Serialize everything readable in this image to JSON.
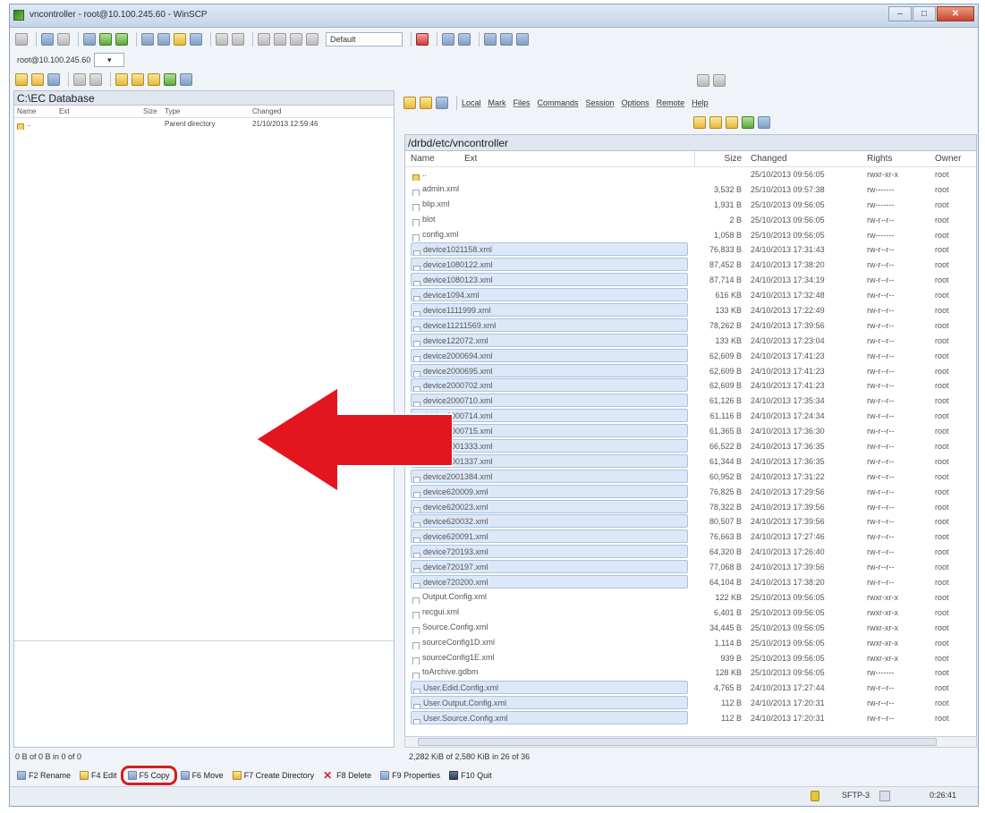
{
  "window": {
    "title": "vncontroller - root@10.100.245.60 - WinSCP",
    "controls": [
      "–",
      "□",
      "✕"
    ]
  },
  "toolbar": {
    "profile_dropdown": "Default"
  },
  "session": {
    "tab_label": "root@10.100.245.60",
    "new_tab": "▾"
  },
  "left_panel": {
    "path": "C:\\EC Database",
    "columns": {
      "name": "Name",
      "ext": "Ext",
      "size": "Size",
      "type": "Type",
      "changed": "Changed"
    },
    "rows": [
      {
        "name": "..",
        "ext": "",
        "size": "",
        "type": "Parent directory",
        "changed": "21/10/2013 12:59:46"
      }
    ],
    "status": "0 B of 0 B in 0 of 0"
  },
  "right_panel": {
    "menu": [
      "Local",
      "Mark",
      "Files",
      "Commands",
      "Session",
      "Options",
      "Remote",
      "Help"
    ],
    "path": "/drbd/etc/vncontroller",
    "columns": {
      "name": "Name",
      "ext": "Ext",
      "size": "Size",
      "changed": "Changed",
      "rights": "Rights",
      "owner": "Owner"
    },
    "rows": [
      {
        "name": "..",
        "size": "",
        "changed": "25/10/2013 09:56:05",
        "rights": "rwxr-xr-x",
        "owner": "root",
        "selected": false,
        "up": true
      },
      {
        "name": "admin.xml",
        "size": "3,532 B",
        "changed": "25/10/2013 09:57:38",
        "rights": "rw-------",
        "owner": "root",
        "selected": false
      },
      {
        "name": "blip.xml",
        "size": "1,931 B",
        "changed": "25/10/2013 09:56:05",
        "rights": "rw-------",
        "owner": "root",
        "selected": false
      },
      {
        "name": "blot",
        "size": "2 B",
        "changed": "25/10/2013 09:56:05",
        "rights": "rw-r--r--",
        "owner": "root",
        "selected": false
      },
      {
        "name": "config.xml",
        "size": "1,058 B",
        "changed": "25/10/2013 09:56:05",
        "rights": "rw-------",
        "owner": "root",
        "selected": false
      },
      {
        "name": "device1021158.xml",
        "size": "76,833 B",
        "changed": "24/10/2013 17:31:43",
        "rights": "rw-r--r--",
        "owner": "root",
        "selected": true
      },
      {
        "name": "device1080122.xml",
        "size": "87,452 B",
        "changed": "24/10/2013 17:38:20",
        "rights": "rw-r--r--",
        "owner": "root",
        "selected": true
      },
      {
        "name": "device1080123.xml",
        "size": "87,714 B",
        "changed": "24/10/2013 17:34:19",
        "rights": "rw-r--r--",
        "owner": "root",
        "selected": true
      },
      {
        "name": "device1094.xml",
        "size": "616 KB",
        "changed": "24/10/2013 17:32:48",
        "rights": "rw-r--r--",
        "owner": "root",
        "selected": true
      },
      {
        "name": "device1111999.xml",
        "size": "133 KB",
        "changed": "24/10/2013 17:22:49",
        "rights": "rw-r--r--",
        "owner": "root",
        "selected": true
      },
      {
        "name": "device11211569.xml",
        "size": "78,262 B",
        "changed": "24/10/2013 17:39:56",
        "rights": "rw-r--r--",
        "owner": "root",
        "selected": true
      },
      {
        "name": "device122072.xml",
        "size": "133 KB",
        "changed": "24/10/2013 17:23:04",
        "rights": "rw-r--r--",
        "owner": "root",
        "selected": true
      },
      {
        "name": "device2000694.xml",
        "size": "62,609 B",
        "changed": "24/10/2013 17:41:23",
        "rights": "rw-r--r--",
        "owner": "root",
        "selected": true
      },
      {
        "name": "device2000695.xml",
        "size": "62,609 B",
        "changed": "24/10/2013 17:41:23",
        "rights": "rw-r--r--",
        "owner": "root",
        "selected": true
      },
      {
        "name": "device2000702.xml",
        "size": "62,609 B",
        "changed": "24/10/2013 17:41:23",
        "rights": "rw-r--r--",
        "owner": "root",
        "selected": true
      },
      {
        "name": "device2000710.xml",
        "size": "61,126 B",
        "changed": "24/10/2013 17:35:34",
        "rights": "rw-r--r--",
        "owner": "root",
        "selected": true
      },
      {
        "name": "device2000714.xml",
        "size": "61,116 B",
        "changed": "24/10/2013 17:24:34",
        "rights": "rw-r--r--",
        "owner": "root",
        "selected": true
      },
      {
        "name": "device2000715.xml",
        "size": "61,365 B",
        "changed": "24/10/2013 17:36:30",
        "rights": "rw-r--r--",
        "owner": "root",
        "selected": true
      },
      {
        "name": "device2001333.xml",
        "size": "66,522 B",
        "changed": "24/10/2013 17:36:35",
        "rights": "rw-r--r--",
        "owner": "root",
        "selected": true
      },
      {
        "name": "device2001337.xml",
        "size": "61,344 B",
        "changed": "24/10/2013 17:36:35",
        "rights": "rw-r--r--",
        "owner": "root",
        "selected": true
      },
      {
        "name": "device2001384.xml",
        "size": "60,952 B",
        "changed": "24/10/2013 17:31:22",
        "rights": "rw-r--r--",
        "owner": "root",
        "selected": true
      },
      {
        "name": "device620009.xml",
        "size": "76,825 B",
        "changed": "24/10/2013 17:29:56",
        "rights": "rw-r--r--",
        "owner": "root",
        "selected": true
      },
      {
        "name": "device620023.xml",
        "size": "78,322 B",
        "changed": "24/10/2013 17:39:56",
        "rights": "rw-r--r--",
        "owner": "root",
        "selected": true
      },
      {
        "name": "device620032.xml",
        "size": "80,507 B",
        "changed": "24/10/2013 17:39:56",
        "rights": "rw-r--r--",
        "owner": "root",
        "selected": true
      },
      {
        "name": "device620091.xml",
        "size": "76,663 B",
        "changed": "24/10/2013 17:27:46",
        "rights": "rw-r--r--",
        "owner": "root",
        "selected": true
      },
      {
        "name": "device720193.xml",
        "size": "64,320 B",
        "changed": "24/10/2013 17:26:40",
        "rights": "rw-r--r--",
        "owner": "root",
        "selected": true
      },
      {
        "name": "device720197.xml",
        "size": "77,068 B",
        "changed": "24/10/2013 17:39:56",
        "rights": "rw-r--r--",
        "owner": "root",
        "selected": true
      },
      {
        "name": "device720200.xml",
        "size": "64,104 B",
        "changed": "24/10/2013 17:38:20",
        "rights": "rw-r--r--",
        "owner": "root",
        "selected": true
      },
      {
        "name": "Output.Config.xml",
        "size": "122 KB",
        "changed": "25/10/2013 09:56:05",
        "rights": "rwxr-xr-x",
        "owner": "root",
        "selected": false
      },
      {
        "name": "recgui.xml",
        "size": "6,401 B",
        "changed": "25/10/2013 09:56:05",
        "rights": "rwxr-xr-x",
        "owner": "root",
        "selected": false
      },
      {
        "name": "Source.Config.xml",
        "size": "34,445 B",
        "changed": "25/10/2013 09:56:05",
        "rights": "rwxr-xr-x",
        "owner": "root",
        "selected": false
      },
      {
        "name": "sourceConfig1D.xml",
        "size": "1,114 B",
        "changed": "25/10/2013 09:56:05",
        "rights": "rwxr-xr-x",
        "owner": "root",
        "selected": false
      },
      {
        "name": "sourceConfig1E.xml",
        "size": "939 B",
        "changed": "25/10/2013 09:56:05",
        "rights": "rwxr-xr-x",
        "owner": "root",
        "selected": false
      },
      {
        "name": "toArchive.gdbm",
        "size": "128 KB",
        "changed": "25/10/2013 09:56:05",
        "rights": "rw-------",
        "owner": "root",
        "selected": false
      },
      {
        "name": "User.Edid.Config.xml",
        "size": "4,765 B",
        "changed": "24/10/2013 17:27:44",
        "rights": "rw-r--r--",
        "owner": "root",
        "selected": true
      },
      {
        "name": "User.Output.Config.xml",
        "size": "112 B",
        "changed": "24/10/2013 17:20:31",
        "rights": "rw-r--r--",
        "owner": "root",
        "selected": true
      },
      {
        "name": "User.Source.Config.xml",
        "size": "112 B",
        "changed": "24/10/2013 17:20:31",
        "rights": "rw-r--r--",
        "owner": "root",
        "selected": true
      }
    ],
    "status": "2,282 KiB of 2,580 KiB in 26 of 36"
  },
  "function_keys": [
    {
      "label": "F2 Rename",
      "icon": "rename-icon"
    },
    {
      "label": "F4 Edit",
      "icon": "edit-icon"
    },
    {
      "label": "F5 Copy",
      "icon": "copy-icon",
      "highlight": true
    },
    {
      "label": "F6 Move",
      "icon": "move-icon"
    },
    {
      "label": "F7 Create Directory",
      "icon": "folder-icon"
    },
    {
      "label": "F8 Delete",
      "icon": "delete-icon"
    },
    {
      "label": "F9 Properties",
      "icon": "properties-icon"
    },
    {
      "label": "F10 Quit",
      "icon": "quit-icon"
    }
  ],
  "statusbar": {
    "protocol": "SFTP-3",
    "elapsed": "0:26:41"
  },
  "colors": {
    "highlight_red": "#d11f1f",
    "selection": "#dce8f7",
    "arrow_red": "#e3151e"
  }
}
